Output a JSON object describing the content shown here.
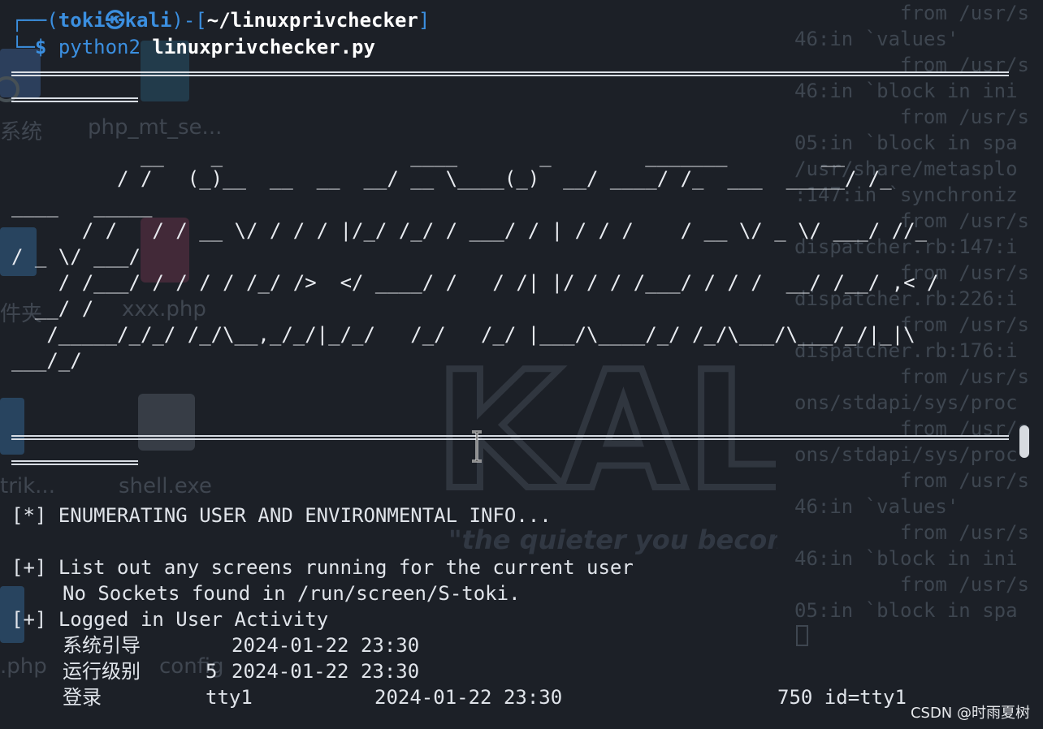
{
  "desktop": {
    "icons": [
      {
        "label": "系统"
      },
      {
        "label": "php_mt_se..."
      },
      {
        "label": "件夹"
      },
      {
        "label": "xxx.php"
      },
      {
        "label": "trik..."
      },
      {
        "label": "shell.exe"
      },
      {
        "label": ".php"
      },
      {
        "label": "config"
      }
    ],
    "watermark_text": "KALI",
    "motto": "\"the quieter you become"
  },
  "back_terminal": {
    "lines": [
      "from /usr/s",
      "46:in `values'",
      "from /usr/s",
      "46:in `block in ini",
      "from /usr/s",
      "05:in `block in spa",
      "/usr/share/metasplo",
      ":147:in `synchroniz",
      "from /usr/s",
      "dispatcher.rb:147:i",
      "from /usr/s",
      "dispatcher.rb:226:i",
      "from /usr/s",
      "dispatcher.rb:176:i",
      "from /usr/s",
      "ons/stdapi/sys/proc",
      "from /usr/s",
      "ons/stdapi/sys/proc",
      "from /usr/s",
      "46:in `values'",
      "from /usr/s",
      "46:in `block in ini",
      "from /usr/s",
      "05:in `block in spa"
    ]
  },
  "terminal": {
    "prompt": {
      "frame_top": "┌──(",
      "user": "toki",
      "at": "㉿",
      "host": "kali",
      "mid": ")-[",
      "path": "~/linuxprivchecker",
      "end": "]",
      "frame_bottom": "└─",
      "dollar": "$",
      "command_prog": "python2",
      "command_arg": "linuxprivchecker.py"
    },
    "ascii_art": [
      "           __    _                ____       _        _______        __",
      "         / /   (_)__  __  __  __/ __ \\____(_)  __/ ____/ /_  ___  _____/ /_",
      "____   _____",
      "      / /   / / __ \\/ / / / |/_/ /_/ / ___/ / | / / /    / __ \\/ _ \\/ ___/ //_",
      "/ _ \\/ ___/",
      "    / /___/ / / / / /_/ />  </ ____/ /   / /| |/ / / /___/ / / /  __/ /__/ ,< /",
      "  __/ /",
      "   /_____/_/_/ /_/\\__,_/_/|_/_/   /_/   /_/ |___/\\____/_/ /_/\\___/\\___/_/|_|\\",
      "___/_/"
    ],
    "section": "[*] ENUMERATING USER AND ENVIRONMENTAL INFO...",
    "items": [
      {
        "marker": "[+]",
        "title": "List out any screens running for the current user"
      },
      {
        "marker": "[+]",
        "title": "Logged in User Activity"
      }
    ],
    "screens_output": "No Sockets found in /run/screen/S-toki.",
    "activity": [
      {
        "col1": "系统引导",
        "col2": "",
        "col3": "2024-01-22 23:30",
        "col4": ""
      },
      {
        "col1": "运行级别",
        "col2": "5",
        "col3": "2024-01-22 23:30",
        "col4": ""
      },
      {
        "col1": "登录",
        "col2": "tty1",
        "col3": "2024-01-22 23:30",
        "col4": "750 id=tty1"
      }
    ]
  },
  "watermark_credit": "CSDN @时雨夏树"
}
